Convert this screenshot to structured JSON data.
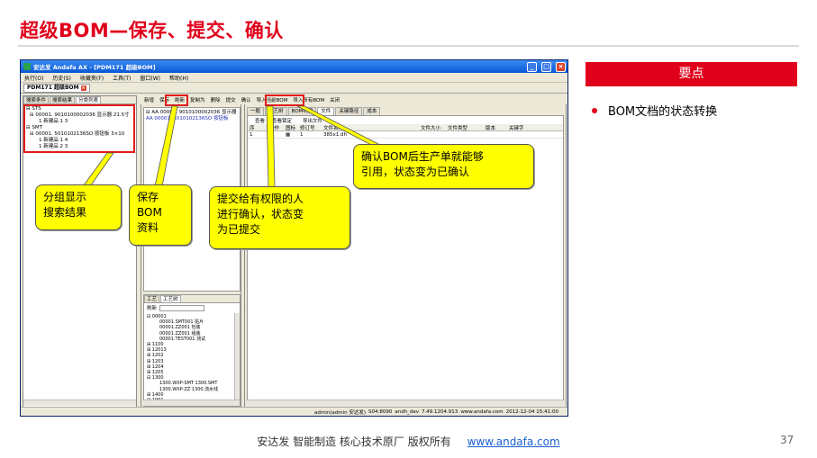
{
  "slide": {
    "title": "超级BOM—保存、提交、确认",
    "page_number": "37",
    "footer_text": "安达发   智能制造 核心技术原厂   版权所有",
    "footer_link": "www.andafa.com"
  },
  "side_panel": {
    "header": "要点",
    "bullet": "BOM文档的状态转换"
  },
  "callouts": {
    "group": "分组显示\n搜索结果",
    "save": "保存\nBOM\n资料",
    "submit": "提交给有权限的人\n进行确认，状态变\n为已提交",
    "confirm": "确认BOM后生产单就能够\n引用，状态变为已确认"
  },
  "app": {
    "title": "安达发 Andafa AX - [PDM171 超级BOM]",
    "menu": [
      "执行(O)",
      "历史(S)",
      "收藏夹(F)",
      "工具(T)",
      "窗口(W)",
      "帮助(H)"
    ],
    "doc_tab": "PDM171 超级BOM",
    "left_tabs": [
      "搜索条件",
      "搜索结果",
      "分类列表"
    ],
    "left_tree": [
      {
        "level": 0,
        "text": "⊟ STS"
      },
      {
        "level": 1,
        "text": "⊟ 00001. 9010100002036 显示器 21.5寸"
      },
      {
        "level": 2,
        "text": "1  新建品  1 3"
      },
      {
        "level": 0,
        "text": "⊟ SMT"
      },
      {
        "level": 1,
        "text": "⊟ 00001. 5010102136SO 按钮板 3×10"
      },
      {
        "level": 2,
        "text": "1  新建品  1 4"
      },
      {
        "level": 2,
        "text": "1  新建品  2 3"
      }
    ],
    "toolbar": [
      "新增",
      "保存",
      "刷新",
      "复制为",
      "删除",
      "提交",
      "确认",
      "导入当前BOM",
      "导入所有BOM",
      "关闭"
    ],
    "mid_tree": [
      {
        "text": "⊟ AA 00001. 9010100002036 显示器",
        "link": false
      },
      {
        "text": "   AA 00001. 5010102136SO 按钮板",
        "link": true
      }
    ],
    "mid_lower_tabs": [
      "工艺",
      "工艺树"
    ],
    "refresh_label": "刷新",
    "process_tree": [
      {
        "level": 0,
        "text": "⊟ 00001"
      },
      {
        "level": 2,
        "text": "00001.SMT001 贴片"
      },
      {
        "level": 2,
        "text": "00001.ZZ001 包装"
      },
      {
        "level": 2,
        "text": "00001.ZZ001 组装"
      },
      {
        "level": 2,
        "text": "00001.TEST001 测试"
      },
      {
        "level": 0,
        "text": "⊞ 1100"
      },
      {
        "level": 0,
        "text": "⊞ 12013"
      },
      {
        "level": 0,
        "text": "⊞ 1202"
      },
      {
        "level": 0,
        "text": "⊞ 1203"
      },
      {
        "level": 0,
        "text": "⊞ 1204"
      },
      {
        "level": 0,
        "text": "⊞ 1205"
      },
      {
        "level": 0,
        "text": "⊟ 1300"
      },
      {
        "level": 2,
        "text": "1300.WXP-SMT 1300.SMT"
      },
      {
        "level": 2,
        "text": "1300.WXP-ZZ 1300.流水线"
      },
      {
        "level": 0,
        "text": "⊞ 1400"
      },
      {
        "level": 0,
        "text": "⊞ 1901"
      }
    ],
    "right_tabs": [
      "一般",
      "工艺树",
      "BOM明细",
      "文件",
      "关键路径",
      "成本"
    ],
    "right_tools": [
      "查看",
      "查看锁定",
      "导出文件"
    ],
    "right_headers": [
      "序",
      "动作",
      "图标",
      "修订号",
      "文件名称",
      "文件大小",
      "文件类型",
      "版本",
      "关键字"
    ],
    "right_row": [
      "1",
      "",
      "",
      "1",
      "385x1.dh",
      "",
      "",
      "",
      ""
    ],
    "status": [
      "admin(admin 安达发)",
      "S04:8090",
      "andh_dev",
      "7.49.1204.913",
      "www.andafa.com",
      "2012-12-04 15:41:00"
    ]
  },
  "colors": {
    "accent_red": "#e0001b",
    "callout_yellow": "#ffff00",
    "highlight_red": "#e31a1a"
  }
}
